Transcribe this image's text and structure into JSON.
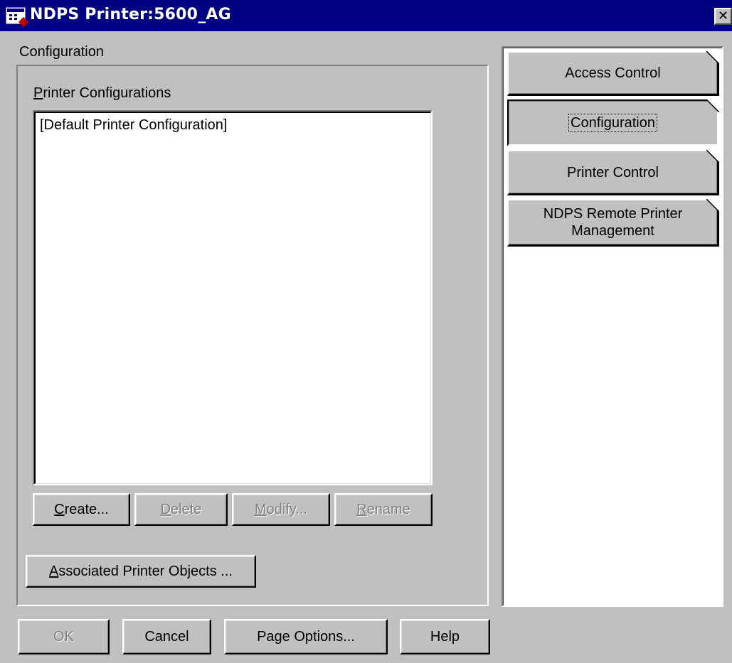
{
  "window": {
    "title": "NDPS Printer:5600_AG",
    "close_symbol": "✕"
  },
  "page": {
    "heading": "Configuration"
  },
  "printer_configurations": {
    "label_mnemonic": "P",
    "label_rest": "rinter Configurations",
    "items": [
      "[Default Printer Configuration]"
    ]
  },
  "list_buttons": {
    "create": {
      "mnemonic": "C",
      "rest": "reate...",
      "enabled": true
    },
    "delete": {
      "mnemonic": "D",
      "rest": "elete",
      "enabled": false
    },
    "modify": {
      "mnemonic": "M",
      "rest": "odify...",
      "enabled": false
    },
    "rename": {
      "mnemonic": "R",
      "rest": "ename",
      "enabled": false
    }
  },
  "associated": {
    "mnemonic": "A",
    "rest": "ssociated Printer Objects ..."
  },
  "pages": [
    {
      "label": "Access Control",
      "active": false
    },
    {
      "label": "Configuration",
      "active": true
    },
    {
      "label": "Printer Control",
      "active": false
    },
    {
      "label": "NDPS Remote Printer Management",
      "active": false
    }
  ],
  "dialog_buttons": {
    "ok": {
      "label": "OK",
      "enabled": false
    },
    "cancel": {
      "label": "Cancel",
      "enabled": true
    },
    "page_options": {
      "label": "Page Options...",
      "enabled": true
    },
    "help": {
      "label": "Help",
      "enabled": true
    }
  },
  "icons": {
    "app": "printer-object-icon",
    "close": "close-icon",
    "page_corner": "dog-ear-icon"
  }
}
